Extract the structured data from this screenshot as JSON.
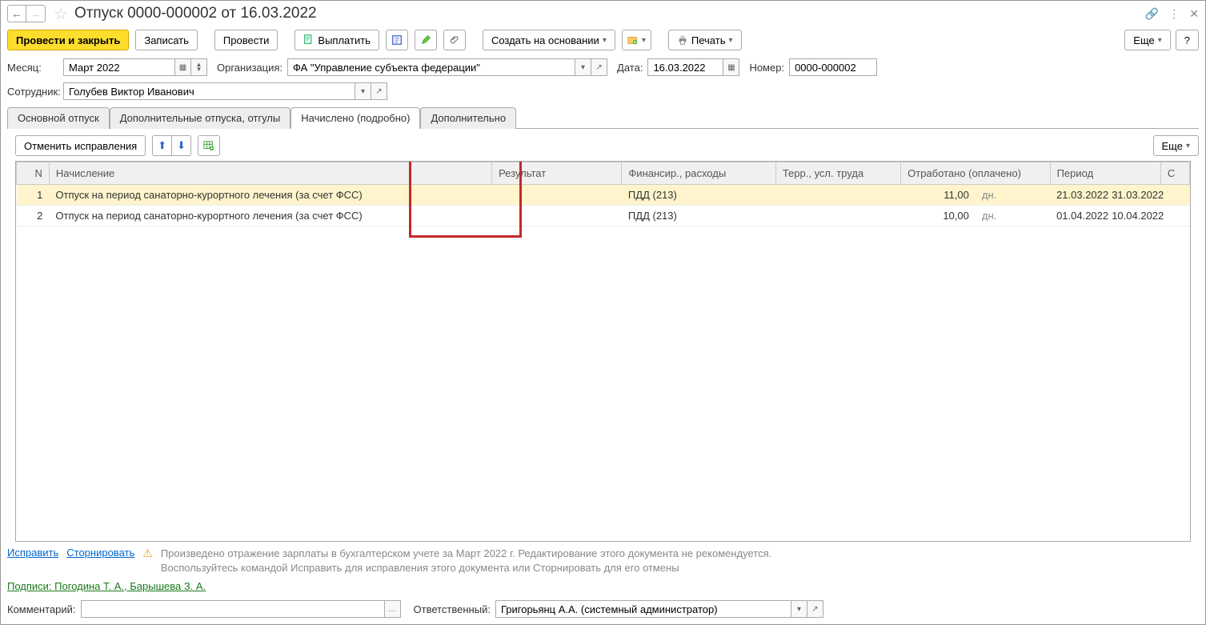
{
  "title": "Отпуск 0000-000002 от 16.03.2022",
  "toolbar": {
    "post_close": "Провести и закрыть",
    "save": "Записать",
    "post": "Провести",
    "pay": "Выплатить",
    "create_based": "Создать на основании",
    "print": "Печать",
    "more": "Еще"
  },
  "fields": {
    "month_label": "Месяц:",
    "month_value": "Март 2022",
    "org_label": "Организация:",
    "org_value": "ФА \"Управление субъекта федерации\"",
    "date_label": "Дата:",
    "date_value": "16.03.2022",
    "number_label": "Номер:",
    "number_value": "0000-000002",
    "employee_label": "Сотрудник:",
    "employee_value": "Голубев Виктор Иванович"
  },
  "tabs": {
    "main": "Основной отпуск",
    "extra": "Дополнительные отпуска, отгулы",
    "accrued": "Начислено (подробно)",
    "additional": "Дополнительно"
  },
  "subtoolbar": {
    "undo": "Отменить исправления",
    "more": "Еще"
  },
  "table": {
    "headers": {
      "n": "N",
      "accrual": "Начисление",
      "result": "Результат",
      "finance": "Финансир., расходы",
      "terr": "Терр., усл. труда",
      "worked": "Отработано (оплачено)",
      "period": "Период",
      "c": "С"
    },
    "rows": [
      {
        "n": "1",
        "accrual": "Отпуск на период санаторно-курортного лечения (за счет ФСС)",
        "result": "",
        "finance": "ПДД (213)",
        "terr": "",
        "worked": "11,00",
        "unit": "дн.",
        "period_from": "21.03.2022",
        "period_to": "31.03.2022"
      },
      {
        "n": "2",
        "accrual": "Отпуск на период санаторно-курортного лечения (за счет ФСС)",
        "result": "",
        "finance": "ПДД (213)",
        "terr": "",
        "worked": "10,00",
        "unit": "дн.",
        "period_from": "01.04.2022",
        "period_to": "10.04.2022"
      }
    ]
  },
  "footer": {
    "fix": "Исправить",
    "reverse": "Сторнировать",
    "warning1": "Произведено отражение зарплаты в бухгалтерском учете за Март 2022 г. Редактирование этого документа не рекомендуется.",
    "warning2": "Воспользуйтесь командой Исправить для исправления этого документа или Сторнировать для его отмены",
    "signatures": "Подписи: Погодина Т. А., Барышева З. А.",
    "comment_label": "Комментарий:",
    "comment_value": "",
    "responsible_label": "Ответственный:",
    "responsible_value": "Григорьянц А.А. (системный администратор)"
  }
}
